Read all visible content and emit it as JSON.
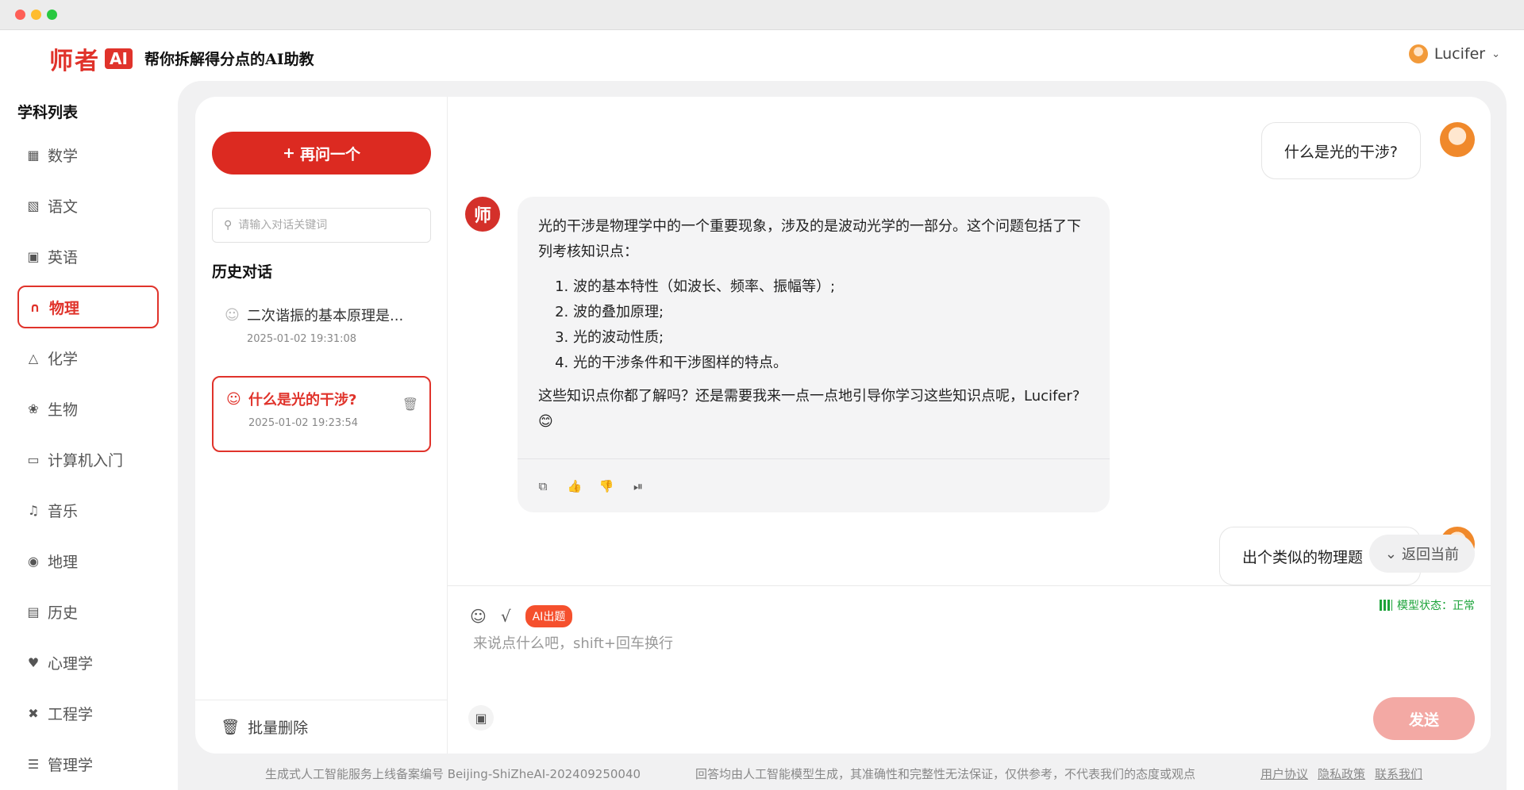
{
  "window": {
    "title": ""
  },
  "header": {
    "logo_text": "师者",
    "logo_badge": "AI",
    "slogan": "帮你拆解得分点的AI助教",
    "user_name": "Lucifer"
  },
  "sidebar": {
    "title": "学科列表",
    "items": [
      {
        "label": "数学",
        "icon": "calculator-icon"
      },
      {
        "label": "语文",
        "icon": "book-icon"
      },
      {
        "label": "英语",
        "icon": "english-book-icon"
      },
      {
        "label": "物理",
        "icon": "magnet-icon",
        "active": true
      },
      {
        "label": "化学",
        "icon": "flask-icon"
      },
      {
        "label": "生物",
        "icon": "bug-icon"
      },
      {
        "label": "计算机入门",
        "icon": "monitor-icon"
      },
      {
        "label": "音乐",
        "icon": "music-note-icon"
      },
      {
        "label": "地理",
        "icon": "globe-icon"
      },
      {
        "label": "历史",
        "icon": "history-icon"
      },
      {
        "label": "心理学",
        "icon": "heart-icon"
      },
      {
        "label": "工程学",
        "icon": "tools-icon"
      },
      {
        "label": "管理学",
        "icon": "layers-icon"
      }
    ]
  },
  "history": {
    "new_button": "再问一个",
    "search_placeholder": "请输入对话关键词",
    "title": "历史对话",
    "items": [
      {
        "title": "二次谐振的基本原理是...",
        "time": "2025-01-02 19:31:08"
      },
      {
        "title": "什么是光的干涉?",
        "time": "2025-01-02 19:23:54",
        "active": true
      }
    ],
    "batch_delete": "批量删除"
  },
  "chat": {
    "user_message_1": "什么是光的干涉?",
    "bot_avatar": "师",
    "bot_intro": "光的干涉是物理学中的一个重要现象，涉及的是波动光学的一部分。这个问题包括了下列考核知识点：",
    "bot_points": [
      "波的基本特性（如波长、频率、振幅等）;",
      "波的叠加原理;",
      "光的波动性质;",
      "光的干涉条件和干涉图样的特点。"
    ],
    "bot_outro": "这些知识点你都了解吗？还是需要我来一点一点地引导你学习这些知识点呢，Lucifer? 😊",
    "user_message_2": "出个类似的物理题",
    "back_to_current": "返回当前"
  },
  "composer": {
    "ai_tag": "AI出题",
    "model_status": "模型状态：正常",
    "placeholder": "来说点什么吧，shift+回车换行",
    "send_label": "发送"
  },
  "footer": {
    "record": "生成式人工智能服务上线备案编号 Beijing-ShiZheAI-202409250040",
    "disclaimer": "回答均由人工智能模型生成，其准确性和完整性无法保证，仅供参考，不代表我们的态度或观点",
    "links": [
      "用户协议",
      "隐私政策",
      "联系我们"
    ]
  },
  "colors": {
    "brand_red": "#dc2a21",
    "send_disabled": "#f3a9a4",
    "status_green": "#1ca33a"
  }
}
